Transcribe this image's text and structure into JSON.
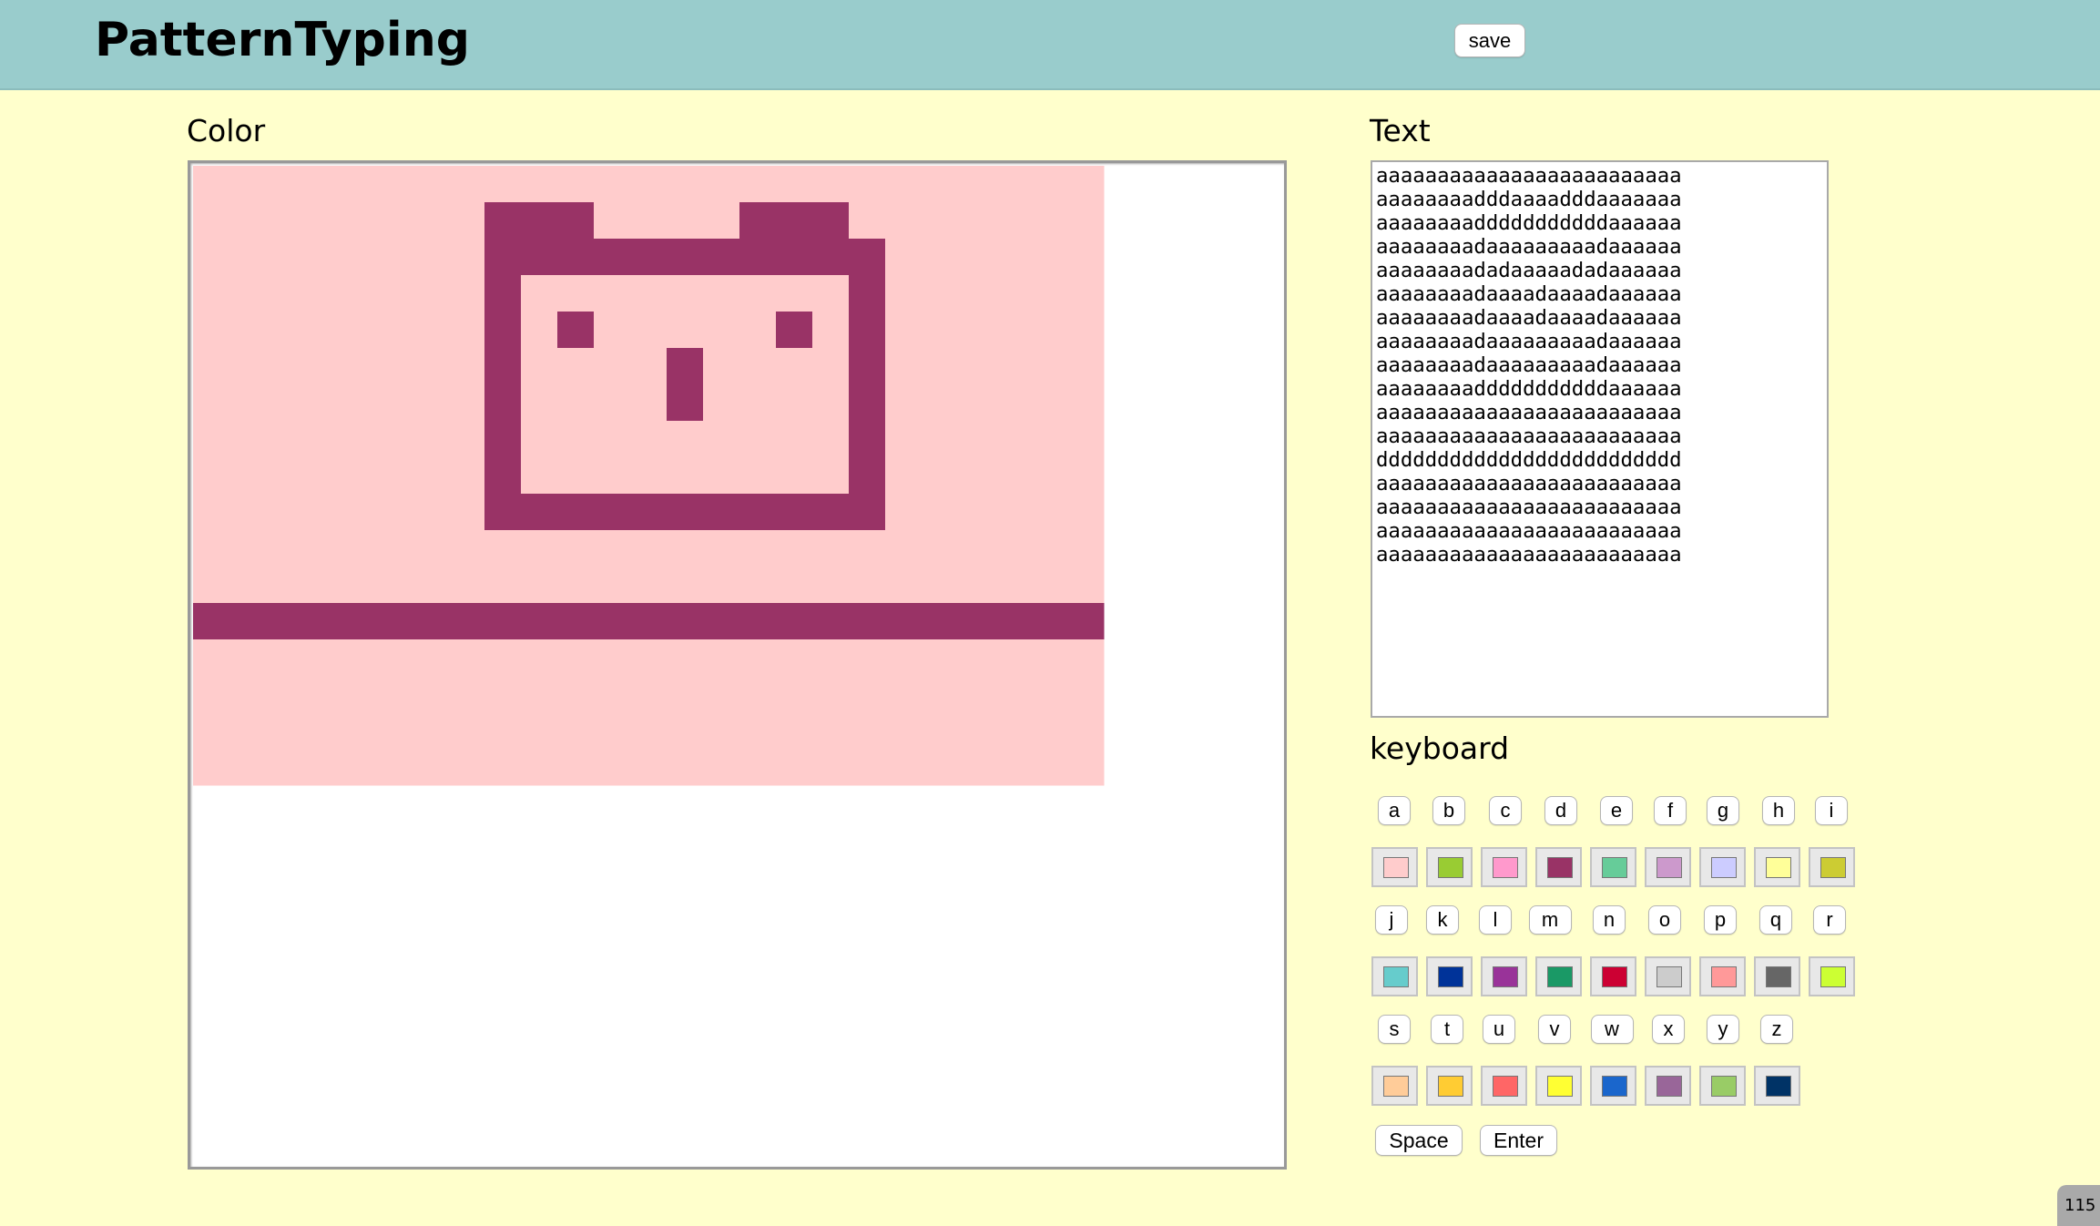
{
  "app": {
    "title": "PatternTyping",
    "save_label": "save"
  },
  "color_panel": {
    "label": "Color"
  },
  "text_panel": {
    "label": "Text",
    "lines": [
      "aaaaaaaaaaaaaaaaaaaaaaaaa",
      "aaaaaaaadddaaaadddaaaaaaa",
      "aaaaaaaadddddddddddaaaaaa",
      "aaaaaaaadaaaaaaaaadaaaaaa",
      "aaaaaaaadadaaaaadadaaaaaa",
      "aaaaaaaadaaaadaaaadaaaaaa",
      "aaaaaaaadaaaadaaaadaaaaaa",
      "aaaaaaaadaaaaaaaaadaaaaaa",
      "aaaaaaaadaaaaaaaaadaaaaaa",
      "aaaaaaaadddddddddddaaaaaa",
      "aaaaaaaaaaaaaaaaaaaaaaaaa",
      "aaaaaaaaaaaaaaaaaaaaaaaaa",
      "ddddddddddddddddddddddddd",
      "aaaaaaaaaaaaaaaaaaaaaaaaa",
      "aaaaaaaaaaaaaaaaaaaaaaaaa",
      "aaaaaaaaaaaaaaaaaaaaaaaaa",
      "aaaaaaaaaaaaaaaaaaaaaaaaa"
    ]
  },
  "keyboard": {
    "label": "keyboard",
    "rows": [
      {
        "letters": [
          "a",
          "b",
          "c",
          "d",
          "e",
          "f",
          "g",
          "h",
          "i"
        ],
        "colors": [
          "#ffcccc",
          "#99cc33",
          "#ff99cc",
          "#993366",
          "#66cc99",
          "#cc99cc",
          "#ccccff",
          "#ffff99",
          "#cccc33"
        ]
      },
      {
        "letters": [
          "j",
          "k",
          "l",
          "m",
          "n",
          "o",
          "p",
          "q",
          "r"
        ],
        "colors": [
          "#66cccc",
          "#003399",
          "#993399",
          "#1a9966",
          "#cc0033",
          "#cccccc",
          "#ff9999",
          "#666666",
          "#ccff33"
        ]
      },
      {
        "letters": [
          "s",
          "t",
          "u",
          "v",
          "w",
          "x",
          "y",
          "z"
        ],
        "colors": [
          "#ffcc99",
          "#ffcc33",
          "#ff6666",
          "#ffff33",
          "#1a66cc",
          "#996699",
          "#99cc66",
          "#003366"
        ]
      }
    ],
    "space_label": "Space",
    "enter_label": "Enter"
  },
  "badge": {
    "text": "115"
  }
}
